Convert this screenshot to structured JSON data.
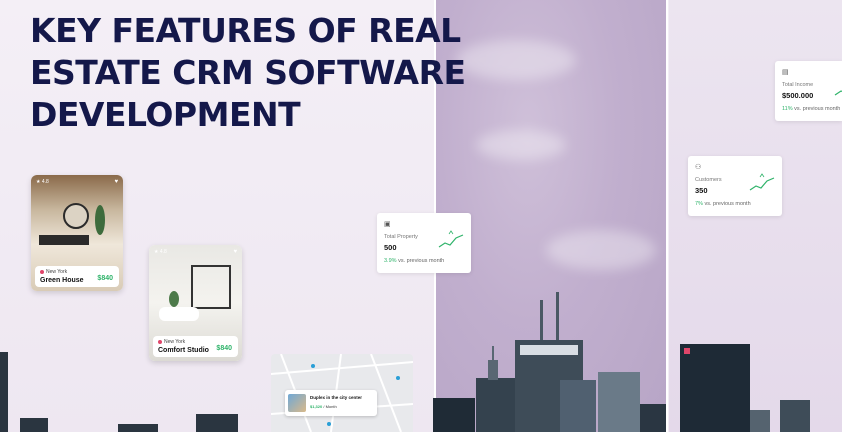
{
  "headline": {
    "line1": "KEY FEATURES OF REAL",
    "line2": "ESTATE CRM SOFTWARE",
    "line3": "DEVELOPMENT"
  },
  "properties": [
    {
      "rating": "4.8",
      "location": "New York",
      "name": "Green House",
      "price": "$840"
    },
    {
      "rating": "4.8",
      "location": "New York",
      "name": "Comfort Studio",
      "price": "$840"
    }
  ],
  "map_listing": {
    "title": "Duplex in the city center",
    "price": "$1,320",
    "unit": "/ Month"
  },
  "stats": [
    {
      "label": "Total Property",
      "value": "500",
      "change_pct": "3.9%",
      "change_text": "vs. previous month"
    },
    {
      "label": "Customers",
      "value": "350",
      "change_pct": "7%",
      "change_text": "vs. previous month"
    },
    {
      "label": "Total Income",
      "value": "$500.000",
      "change_pct": "11%",
      "change_text": "vs. previous month"
    }
  ],
  "colors": {
    "headline": "#14184a",
    "accent_green": "#2fb36a",
    "pin": "#e0466a",
    "sky": "#c1afce"
  },
  "icons": [
    "star-icon",
    "heart-icon",
    "location-pin-icon",
    "building-icon",
    "users-icon",
    "wallet-icon",
    "trend-up-icon"
  ]
}
